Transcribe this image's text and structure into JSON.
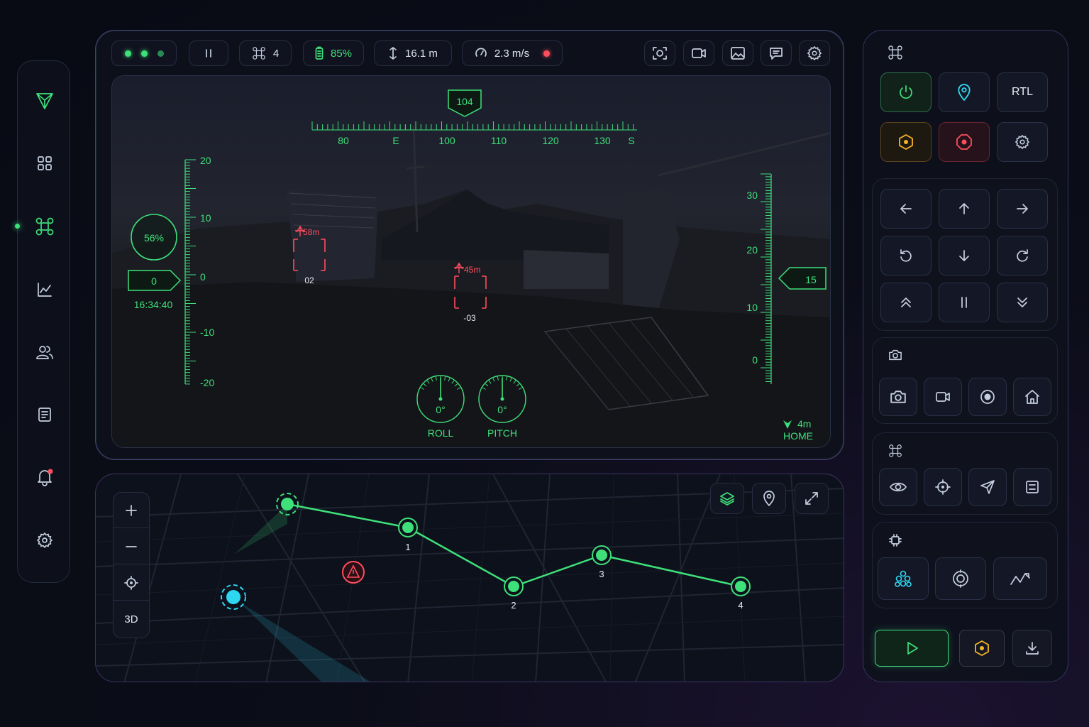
{
  "topbar": {
    "drone_count": "4",
    "battery": "85%",
    "altitude": "16.1 m",
    "speed": "2.3 m/s"
  },
  "hud": {
    "heading": "104",
    "compass_ticks": [
      "80",
      "E",
      "100",
      "110",
      "120",
      "130",
      "S"
    ],
    "left_scale": [
      "20",
      "10",
      "0",
      "-10",
      "-20"
    ],
    "right_scale": [
      "30",
      "20",
      "10",
      "0"
    ],
    "throttle": "56%",
    "left_value": "0",
    "time": "16:34:40",
    "right_value": "15",
    "targets": [
      {
        "distance": "58m",
        "id": "02"
      },
      {
        "distance": "45m",
        "id": "-03"
      }
    ],
    "roll": {
      "value": "0°",
      "label": "ROLL"
    },
    "pitch": {
      "value": "0°",
      "label": "PITCH"
    },
    "home": {
      "distance": "4m",
      "label": "HOME"
    }
  },
  "map": {
    "view_mode": "3D",
    "waypoints": [
      "1",
      "2",
      "3",
      "4"
    ]
  },
  "controls": {
    "rtl_label": "RTL"
  },
  "colors": {
    "accent_green": "#3ee07a",
    "alert_red": "#ff4d5e",
    "warning_amber": "#f5b524",
    "drone_cyan": "#2fd6f0"
  }
}
